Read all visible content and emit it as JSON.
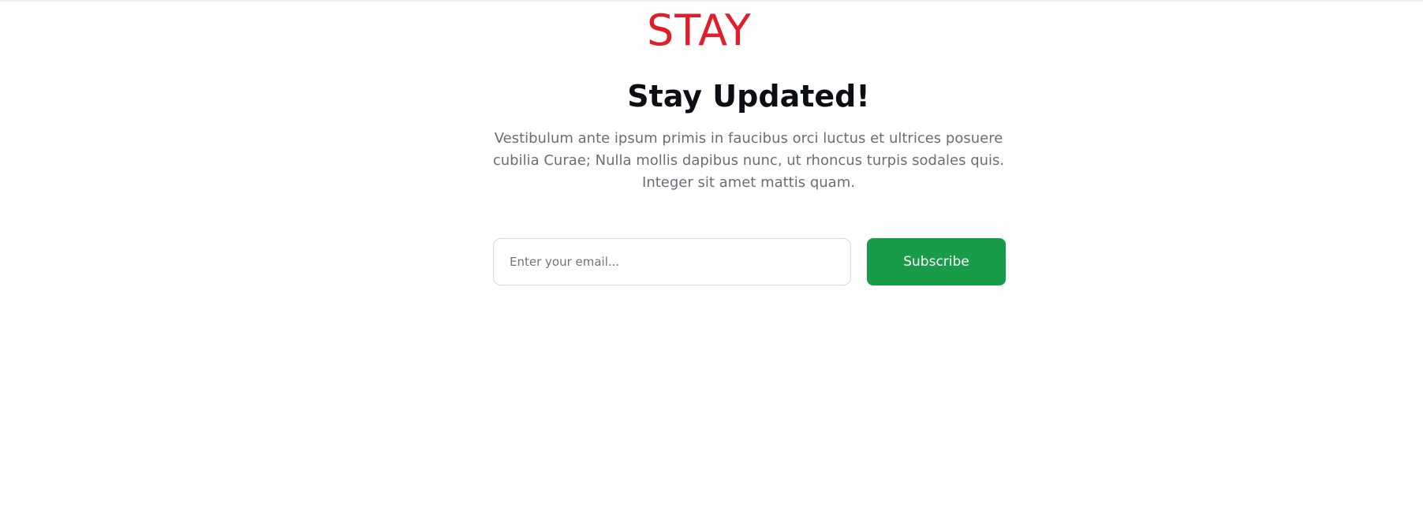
{
  "brand": {
    "logo_text": "STAY",
    "logo_color": "#e11d2a"
  },
  "newsletter": {
    "title": "Stay Updated!",
    "description": "Vestibulum ante ipsum primis in faucibus orci luctus et ultrices posuere cubilia Curae; Nulla mollis dapibus nunc, ut rhoncus turpis sodales quis. Integer sit amet mattis quam.",
    "email_value": "",
    "email_placeholder": "Enter your email...",
    "subscribe_label": "Subscribe",
    "button_color": "#189c4a"
  }
}
